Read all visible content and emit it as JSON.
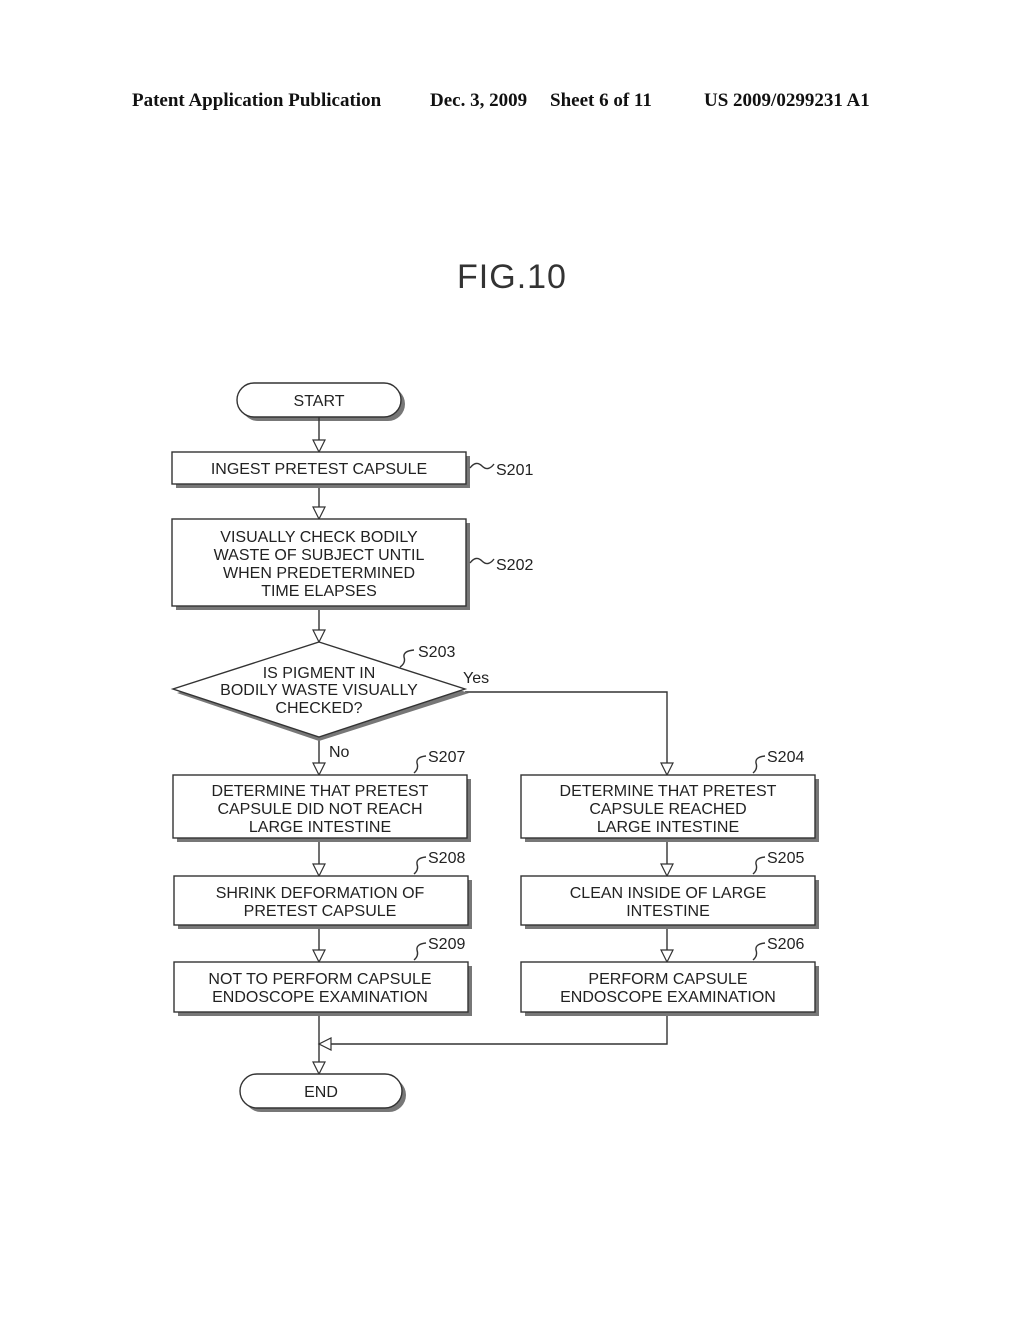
{
  "header": {
    "publication": "Patent Application Publication",
    "date": "Dec. 3, 2009",
    "sheet": "Sheet 6 of 11",
    "number": "US 2009/0299231 A1"
  },
  "figure": {
    "title": "FIG.10",
    "start": "START",
    "end": "END",
    "steps": {
      "s201": {
        "id": "S201",
        "lines": [
          "INGEST PRETEST CAPSULE"
        ]
      },
      "s202": {
        "id": "S202",
        "lines": [
          "VISUALLY CHECK BODILY",
          "WASTE OF SUBJECT UNTIL",
          "WHEN PREDETERMINED",
          "TIME ELAPSES"
        ]
      },
      "s203": {
        "id": "S203",
        "lines": [
          "IS PIGMENT IN",
          "BODILY WASTE VISUALLY",
          "CHECKED?"
        ],
        "yes": "Yes",
        "no": "No"
      },
      "s204": {
        "id": "S204",
        "lines": [
          "DETERMINE THAT PRETEST",
          "CAPSULE REACHED",
          "LARGE INTESTINE"
        ]
      },
      "s205": {
        "id": "S205",
        "lines": [
          "CLEAN INSIDE OF LARGE",
          "INTESTINE"
        ]
      },
      "s206": {
        "id": "S206",
        "lines": [
          "PERFORM CAPSULE",
          "ENDOSCOPE EXAMINATION"
        ]
      },
      "s207": {
        "id": "S207",
        "lines": [
          "DETERMINE THAT PRETEST",
          "CAPSULE DID NOT REACH",
          "LARGE INTESTINE"
        ]
      },
      "s208": {
        "id": "S208",
        "lines": [
          "SHRINK DEFORMATION OF",
          "PRETEST CAPSULE"
        ]
      },
      "s209": {
        "id": "S209",
        "lines": [
          "NOT TO PERFORM CAPSULE",
          "ENDOSCOPE EXAMINATION"
        ]
      }
    }
  }
}
